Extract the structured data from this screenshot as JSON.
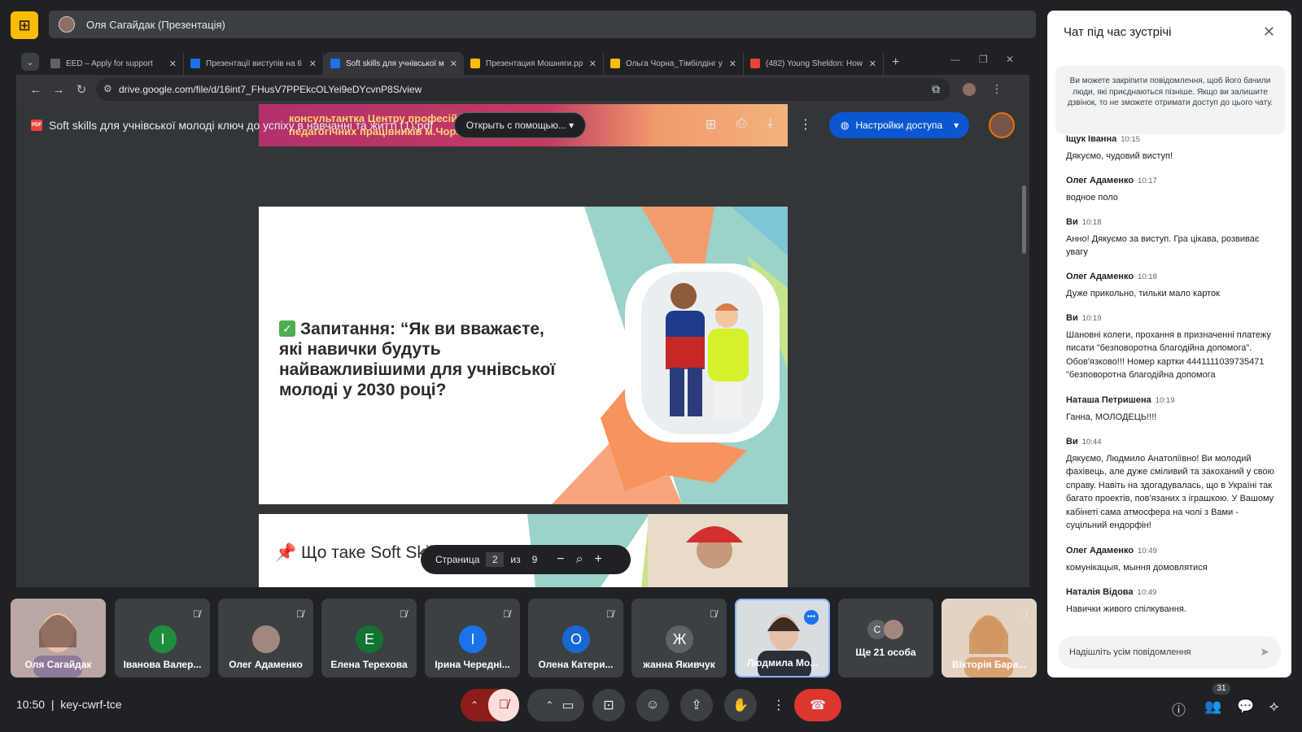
{
  "meet": {
    "logo_glyph": "⊞",
    "presenter_label": "Оля Сагайдак (Презентація)",
    "clock": "10:50",
    "meeting_code": "key-cwrf-tce",
    "participants_badge": "31"
  },
  "browser": {
    "tabs": [
      {
        "title": "EED – Apply for support",
        "color": "#5f6368",
        "active": false
      },
      {
        "title": "Презентації виступів на 6",
        "color": "#1a73e8",
        "active": false
      },
      {
        "title": "Soft skills для учнівської м",
        "color": "#1a73e8",
        "active": true
      },
      {
        "title": "Презентация Мошняги.pp",
        "color": "#fbbc04",
        "active": false
      },
      {
        "title": "Ольга Чорна_Тімбілдінг у",
        "color": "#fbbc04",
        "active": false
      },
      {
        "title": "(482) Young Sheldon: How",
        "color": "#ea4335",
        "active": false
      }
    ],
    "url": "drive.google.com/file/d/16int7_FHusV7PPEkcOLYei9eDYcvnP8S/view"
  },
  "pdf": {
    "file_title": "Soft skills для учнівської молоді ключ до успіху в навчанні та житті (1).pdf",
    "open_with": "Открыть с помощью...",
    "share": "Настройки доступа",
    "slide1_text": "консультантка Центру професійного розвитку педагогічних працівників м.Чорноморська",
    "slide2_question": "Запитання: “Як ви вважаєте, які навички будуть найважливішими для учнівської молоді у 2030 році?",
    "slide3_heading": "Що таке Soft Skills?",
    "page_label": "Страница",
    "page_current": "2",
    "page_of": "из",
    "page_total": "9"
  },
  "tiles": [
    {
      "name": "Оля Сагайдак",
      "initial": "",
      "color": "#9e8a86",
      "muted": false,
      "photo": true
    },
    {
      "name": "Іванова Валер...",
      "initial": "I",
      "color": "#1e8e3e",
      "muted": true,
      "photo": false
    },
    {
      "name": "Олег Адаменко",
      "initial": "",
      "color": "#a1887f",
      "muted": true,
      "photo": false
    },
    {
      "name": "Елена Терехова",
      "initial": "E",
      "color": "#137333",
      "muted": true,
      "photo": false
    },
    {
      "name": "Ірина Чередні...",
      "initial": "I",
      "color": "#1a73e8",
      "muted": true,
      "photo": false
    },
    {
      "name": "Олена Катери...",
      "initial": "O",
      "color": "#1967d2",
      "muted": true,
      "photo": false
    },
    {
      "name": "жанна Якивчук",
      "initial": "Ж",
      "color": "#5f6368",
      "muted": true,
      "photo": false
    },
    {
      "name": "Людмила Мо...",
      "initial": "",
      "color": "#7a8a99",
      "muted": false,
      "photo": true
    },
    {
      "name": "Ще 21 особа",
      "initial": "C",
      "color": "#5f6368",
      "muted": false,
      "photo": false
    },
    {
      "name": "Вікторія Бара...",
      "initial": "",
      "color": "#c9a98a",
      "muted": true,
      "photo": true
    }
  ],
  "chat": {
    "title": "Чат під час зустрічі",
    "note": "Ви можете закріпити повідомлення, щоб його бачили люди, які приєднаються пізніше. Якщо ви залишите дзвінок, то не зможете отримати доступ до цього чату.",
    "messages": [
      {
        "who": "Іщук Іванна",
        "time": "10:15",
        "text": "Дякуємо, чудовий виступ!"
      },
      {
        "who": "Олег Адаменко",
        "time": "10:17",
        "text": "водное поло"
      },
      {
        "who": "Ви",
        "time": "10:18",
        "text": "Анно! Дякуємо за виступ. Гра цікава, розвиває увагу"
      },
      {
        "who": "Олег Адаменко",
        "time": "10:18",
        "text": "Дуже прикольно, тильки мало карток"
      },
      {
        "who": "Ви",
        "time": "10:19",
        "text": "Шановні колеги, прохання в призначенні платежу писати \"безповоротна благодійна допомога\". Обов'язково!!! Номер картки 4441111039735471 \"безповоротна благодійна допомога"
      },
      {
        "who": "Наташа Петришена",
        "time": "10:19",
        "text": "Ганна, МОЛОДЕЦЬ!!!!"
      },
      {
        "who": "Ви",
        "time": "10:44",
        "text": "Дякуємо, Людмило Анатоліївно! Ви молодий фахівець, але дуже сміливий та закоханий у свою справу. Навіть на здогадувалась, що в Україні так багато проектів, пов'язаних з іграшкою. У Вашому кабінеті сама атмосфера на чолі з Вами - суцільний ендорфін!"
      },
      {
        "who": "Олег Адаменко",
        "time": "10:49",
        "text": "комунікацыя, мыння домовлятися"
      },
      {
        "who": "Наталія Відова",
        "time": "10:49",
        "text": "Навички живого спілкування."
      }
    ],
    "input_placeholder": "Надішліть усім повідомлення"
  }
}
